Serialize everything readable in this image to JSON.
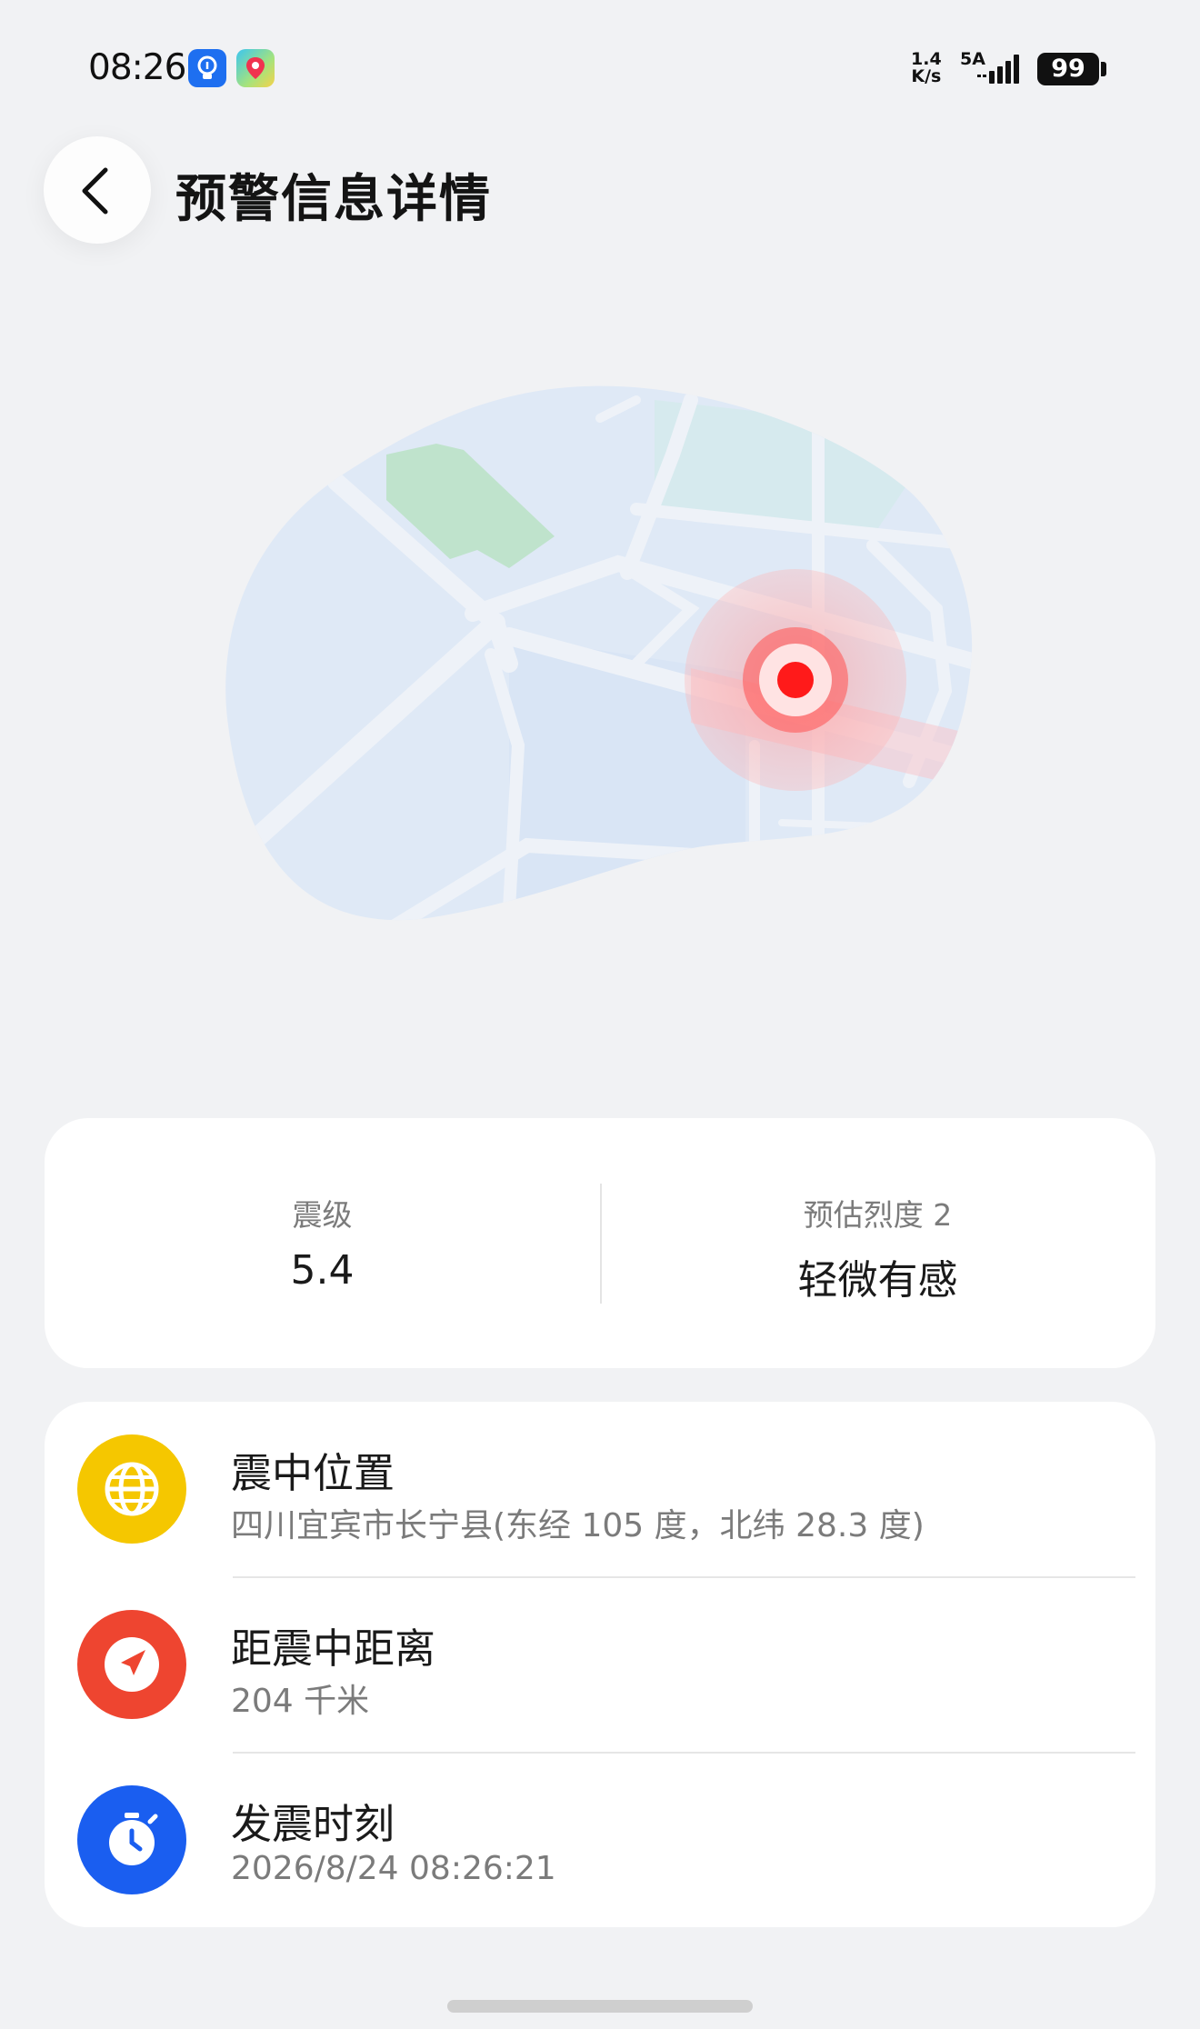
{
  "status_bar": {
    "time": "08:26",
    "net_speed_value": "1.4",
    "net_speed_unit": "K/s",
    "network_gen": "5A",
    "battery": "99",
    "icons": [
      "bulb-app-icon",
      "location-app-icon",
      "signal-icon",
      "battery-icon"
    ]
  },
  "header": {
    "title": "预警信息详情",
    "back_icon": "chevron-left-icon"
  },
  "map": {
    "epicenter_color": "#ff1a1a",
    "land_color": "#dfe9f6",
    "park_color": "#bfe3cc"
  },
  "stats": {
    "magnitude_label": "震级",
    "magnitude_value": "5.4",
    "intensity_label": "预估烈度 2",
    "intensity_value": "轻微有感"
  },
  "info": [
    {
      "icon": "globe-icon",
      "icon_color": "#f5c700",
      "title": "震中位置",
      "subtitle": "四川宜宾市长宁县(东经 105 度，北纬 28.3 度)"
    },
    {
      "icon": "navigation-arrow-icon",
      "icon_color": "#ee4530",
      "title": "距震中距离",
      "subtitle": "204 千米"
    },
    {
      "icon": "stopwatch-icon",
      "icon_color": "#1a5ef0",
      "title": "发震时刻",
      "subtitle": "2026/8/24 08:26:21"
    }
  ]
}
